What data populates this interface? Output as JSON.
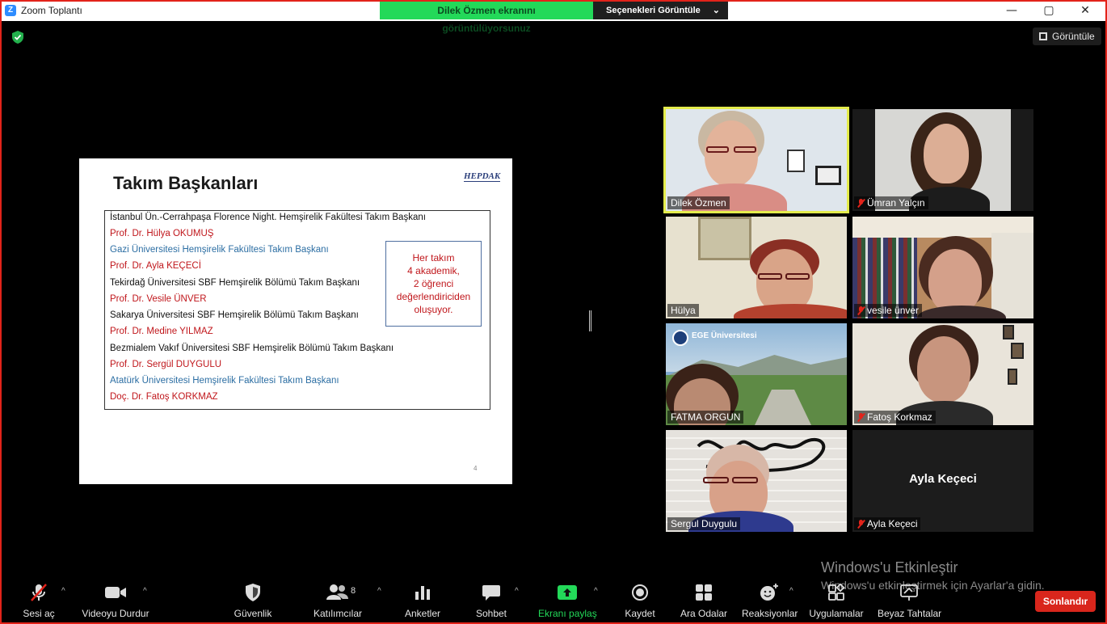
{
  "window": {
    "title": "Zoom Toplantı",
    "app_icon_letter": "Z",
    "controls": {
      "minimize": "—",
      "maximize": "▢",
      "close": "✕"
    }
  },
  "share_banner": {
    "status": "Dilek Özmen ekranını görüntülüyorsunuz",
    "options": "Seçenekleri Görüntüle",
    "options_caret": "⌄"
  },
  "view_button": {
    "label": "Görüntüle"
  },
  "slide": {
    "title": "Takım Başkanları",
    "logo": "HEPDAK",
    "lines": [
      {
        "text": "İstanbul Ün.-Cerrahpaşa Florence Night. Hemşirelik Fakültesi Takım Başkanı",
        "color": "black"
      },
      {
        "text": "Prof. Dr. Hülya OKUMUŞ",
        "color": "red"
      },
      {
        "text": "Gazi Üniversitesi Hemşirelik Fakültesi Takım Başkanı",
        "color": "blue"
      },
      {
        "text": "Prof. Dr. Ayla KEÇECİ",
        "color": "red"
      },
      {
        "text": "Tekirdağ Üniversitesi SBF Hemşirelik Bölümü  Takım Başkanı",
        "color": "black"
      },
      {
        "text": "Prof. Dr. Vesile ÜNVER",
        "color": "red"
      },
      {
        "text": "Sakarya Üniversitesi SBF Hemşirelik Bölümü Takım Başkanı",
        "color": "black"
      },
      {
        "text": "Prof. Dr. Medine YILMAZ",
        "color": "red"
      },
      {
        "text": "Bezmialem Vakıf Üniversitesi SBF Hemşirelik Bölümü Takım Başkanı",
        "color": "black"
      },
      {
        "text": "Prof. Dr. Sergül DUYGULU",
        "color": "red"
      },
      {
        "text": "Atatürk Üniversitesi Hemşirelik Fakültesi Takım Başkanı",
        "color": "blue"
      },
      {
        "text": "Doç. Dr. Fatoş KORKMAZ",
        "color": "red"
      }
    ],
    "callout": [
      "Her takım",
      "4 akademik,",
      "2 öğrenci",
      "değerlendiriciden",
      "oluşuyor."
    ],
    "page_number": "4"
  },
  "participants": [
    {
      "name": "Dilek Özmen",
      "muted": false,
      "active_speaker": true
    },
    {
      "name": "Ümran Yalçın",
      "muted": true
    },
    {
      "name": "Hülya",
      "muted": false
    },
    {
      "name": "vesile ünver",
      "muted": true
    },
    {
      "name": "FATMA ORGUN",
      "muted": false,
      "background_text": "EGE Üniversitesi"
    },
    {
      "name": "Fatoş Korkmaz",
      "muted": true
    },
    {
      "name": "Sergul Duygulu",
      "muted": false
    },
    {
      "name": "Ayla Keçeci",
      "muted": true,
      "video_off": true
    }
  ],
  "watermark": {
    "line1": "Windows'u Etkinleştir",
    "line2": "Windows'u etkinleştirmek için Ayarlar'a gidin."
  },
  "toolbar": {
    "audio": "Sesi aç",
    "video": "Videoyu Durdur",
    "security": "Güvenlik",
    "participants": "Katılımcılar",
    "participants_count": "8",
    "polls": "Anketler",
    "chat": "Sohbet",
    "share": "Ekranı paylaş",
    "record": "Kaydet",
    "breakout": "Ara Odalar",
    "reactions": "Reaksiyonlar",
    "apps": "Uygulamalar",
    "whiteboard": "Beyaz Tahtalar",
    "end": "Sonlandır",
    "caret": "^"
  },
  "colors": {
    "share_green": "#23d959",
    "end_red": "#d9261c",
    "active_outline": "#e4ec4c",
    "slide_red": "#c0161b",
    "slide_blue": "#2c6ea3"
  }
}
